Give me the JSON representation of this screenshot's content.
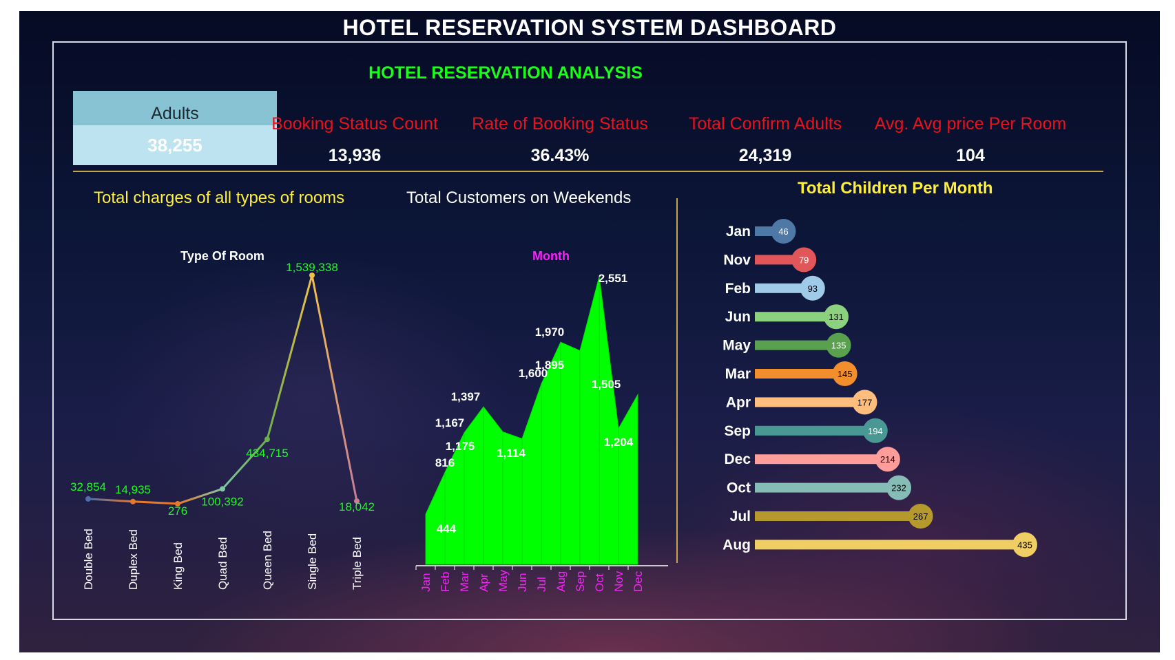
{
  "header": {
    "title": "HOTEL RESERVATION SYSTEM DASHBOARD"
  },
  "analysis": {
    "title": "HOTEL RESERVATION ANALYSIS"
  },
  "kpis": {
    "adults": {
      "label": "Adults",
      "value": "38,255"
    },
    "booking_status_count": {
      "label": "Booking Status Count",
      "value": "13,936"
    },
    "rate_of_booking_status": {
      "label": "Rate of Booking Status",
      "value": "36.43%"
    },
    "total_confirm_adults": {
      "label": "Total Confirm Adults",
      "value": "24,319"
    },
    "avg_price_per_room": {
      "label": "Avg. Avg price Per Room",
      "value": "104"
    }
  },
  "colors": {
    "green_title": "#19ff19",
    "kpi_label_red": "#e8121c",
    "yellow_title": "#ffef3a",
    "month_magenta": "#ff1fff",
    "area_green": "#00ff00",
    "gold_divider": "#c9a449"
  },
  "chart_data": [
    {
      "type": "line",
      "title": "Total charges of all types of rooms",
      "xlabel": "Type Of Room",
      "ylabel": "",
      "categories": [
        "Double Bed",
        "Duplex Bed",
        "King Bed",
        "Quad Bed",
        "Queen Bed",
        "Single Bed",
        "Triple Bed"
      ],
      "values": [
        32854,
        14935,
        276,
        100392,
        434715,
        1539338,
        18042
      ],
      "value_labels": [
        "32,854",
        "14,935",
        "276",
        "100,392",
        "434,715",
        "1,539,338",
        "18,042"
      ],
      "point_colors": [
        "#4c6fa8",
        "#e8792a",
        "#e8792a",
        "#7fc6a4",
        "#6ab04c",
        "#f2c04a",
        "#c77d9a"
      ],
      "grid": false,
      "legend": "none"
    },
    {
      "type": "area",
      "title": "Total Customers on Weekends",
      "xlabel": "Month",
      "ylabel": "",
      "categories": [
        "Jan",
        "Feb",
        "Mar",
        "Apr",
        "May",
        "Jun",
        "Jul",
        "Aug",
        "Sep",
        "Oct",
        "Nov",
        "Dec"
      ],
      "series": [
        {
          "values": [
            444,
            816,
            1167,
            1397,
            1175,
            1114,
            1600,
            1970,
            1895,
            2551,
            1204,
            1505
          ]
        }
      ],
      "point_labels": [
        {
          "month": "Jan",
          "text": "444",
          "color": "#ffffff"
        },
        {
          "month": "Feb",
          "text": "816",
          "color": "#ffffff"
        },
        {
          "month": "Mar",
          "text": "1,167",
          "color": "#ffffff"
        },
        {
          "month": "Apr",
          "text": "1,397",
          "color": "#ffffff"
        },
        {
          "month": "Apr",
          "text": "1,175",
          "color": "#ffffff"
        },
        {
          "month": "Jun",
          "text": "1,600",
          "color": "#ffffff"
        },
        {
          "month": "Jun",
          "text": "1,114",
          "color": "#ffffff"
        },
        {
          "month": "Jul",
          "text": "1,970",
          "color": "#ffffff"
        },
        {
          "month": "Aug",
          "text": "1,895",
          "color": "#ffffff"
        },
        {
          "month": "Oct",
          "text": "2,551",
          "color": "#ffffff"
        },
        {
          "month": "Nov",
          "text": "1,505",
          "color": "#ffffff"
        },
        {
          "month": "Nov",
          "text": "1,204",
          "color": "#ffffff"
        }
      ],
      "grid": false,
      "legend": "none"
    },
    {
      "type": "bar",
      "orientation": "horizontal",
      "title": "Total Children Per Month",
      "categories": [
        "Jan",
        "Nov",
        "Feb",
        "Jun",
        "May",
        "Mar",
        "Apr",
        "Sep",
        "Dec",
        "Oct",
        "Jul",
        "Aug"
      ],
      "values": [
        46,
        79,
        93,
        131,
        135,
        145,
        177,
        194,
        214,
        232,
        267,
        435
      ],
      "colors": [
        "#4e79a7",
        "#e15759",
        "#a0cbe8",
        "#8cd17d",
        "#59a14f",
        "#f28e2b",
        "#ffbe7d",
        "#499894",
        "#ff9d9a",
        "#86bcb6",
        "#b6992d",
        "#f1ce63"
      ],
      "label_colors": [
        "#ffffff",
        "#ffffff",
        "#000000",
        "#000000",
        "#ffffff",
        "#000000",
        "#000000",
        "#ffffff",
        "#000000",
        "#000000",
        "#000000",
        "#000000"
      ],
      "grid": false,
      "legend": "none"
    }
  ]
}
